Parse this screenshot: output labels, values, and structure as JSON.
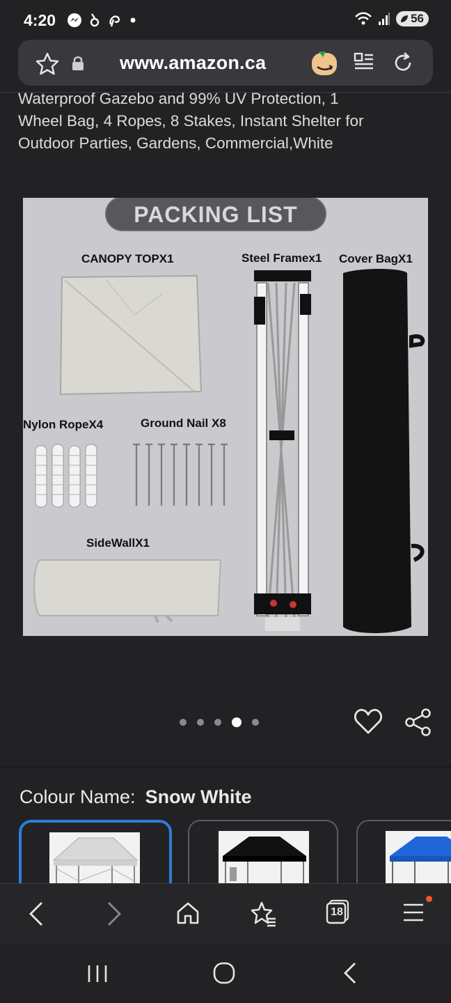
{
  "status_bar": {
    "time": "4:20",
    "battery": "56",
    "icons": [
      "messenger-icon",
      "threads-icon",
      "pinterest-icon",
      "dot-icon",
      "wifi-icon",
      "signal-icon",
      "battery-icon"
    ]
  },
  "browser": {
    "url": "www.amazon.ca",
    "icons": [
      "favorite-star-icon",
      "lock-icon",
      "amazon-extension-icon",
      "reader-mode-icon",
      "reload-icon"
    ]
  },
  "product": {
    "title_lines": [
      "Waterproof Gazebo and 99% UV Protection, 1",
      "Wheel Bag, 4 Ropes, 8 Stakes, Instant Shelter for",
      "Outdoor Parties, Gardens, Commercial,White"
    ]
  },
  "image": {
    "banner": "PACKING LIST",
    "labels": {
      "canopy": "CANOPY TOPX1",
      "frame": "Steel Framex1",
      "bag": "Cover BagX1",
      "rope": "Nylon RopeX4",
      "nail": "Ground Nail X8",
      "sidewall": "SideWallX1"
    }
  },
  "carousel": {
    "total": 5,
    "active_index": 3
  },
  "colour": {
    "label": "Colour Name:",
    "value": "Snow White",
    "swatches": [
      {
        "color": "#ffffff",
        "canopy": "#e6e6e6",
        "selected": true
      },
      {
        "color": "#000000",
        "canopy": "#111111",
        "selected": false
      },
      {
        "color": "#1f5fd6",
        "canopy": "#1f66d8",
        "selected": false
      }
    ]
  },
  "bottom_nav": {
    "tab_count": "18",
    "icons": [
      "back-icon",
      "forward-icon",
      "home-icon",
      "bookmarks-icon",
      "tabs-icon",
      "menu-icon"
    ]
  },
  "android_nav": {
    "icons": [
      "recents-icon",
      "home-circle-icon",
      "system-back-icon"
    ]
  }
}
